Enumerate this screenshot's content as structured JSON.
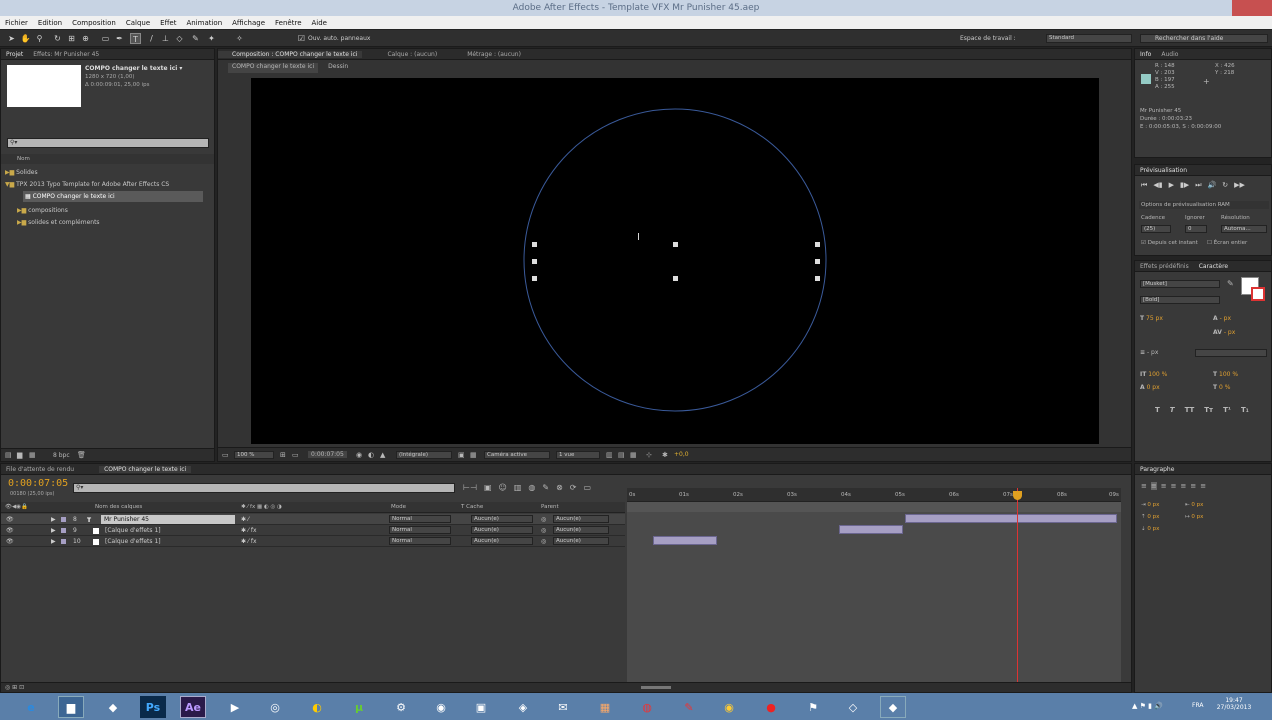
{
  "window": {
    "title": "Adobe After Effects - Template VFX Mr Punisher 45.aep"
  },
  "menu": [
    "Fichier",
    "Edition",
    "Composition",
    "Calque",
    "Effet",
    "Animation",
    "Affichage",
    "Fenêtre",
    "Aide"
  ],
  "toolbar": {
    "auto_open": "Ouv. auto. panneaux",
    "workspace_label": "Espace de travail :",
    "workspace": "Standard",
    "search_placeholder": "Rechercher dans l'aide"
  },
  "project": {
    "tabs": [
      "Projet",
      "Effets: Mr Punisher 45"
    ],
    "selected_name": "COMPO changer le texte ici ▾",
    "selected_size": "1280 x 720 (1,00)",
    "selected_duration": "Δ 0:00:09:01, 25,00 ips",
    "column_name": "Nom",
    "items": [
      "Solides",
      "TPX 2013 Typo Template for Adobe After Effects CS",
      "COMPO changer le texte ici",
      "compositions",
      "solides et compléments"
    ],
    "bpc": "8 bpc"
  },
  "comp": {
    "tabs": [
      "Composition : COMPO changer le texte ici",
      "Calque : (aucun)",
      "Métrage : (aucun)"
    ],
    "subtabs": [
      "COMPO changer le texte ici",
      "Dessin"
    ],
    "zoom": "100 %",
    "timecode": "0:00:07:05",
    "resolution": "(Intégrale)",
    "camera": "Caméra active",
    "views": "1 vue",
    "exposure": "+0,0"
  },
  "info": {
    "tabs": [
      "Info",
      "Audio"
    ],
    "r": "R : 148",
    "v": "V : 203",
    "b": "B : 197",
    "a": "A : 255",
    "x": "X : 426",
    "y": "Y : 218",
    "layer": "Mr Punisher 45",
    "duree": "Durée : 0:00:03:23",
    "range": "E : 0:00:05:03, S : 0:00:09:00"
  },
  "preview": {
    "tab": "Prévisualisation",
    "options": "Options de prévisualisation RAM",
    "cadence_label": "Cadence",
    "ignorer_label": "Ignorer",
    "resolution_label": "Résolution",
    "cadence": "(25)",
    "ignorer": "0",
    "resolution": "Automa...",
    "from_current": "Depuis cet instant",
    "full_screen": "Écran entier"
  },
  "character": {
    "tabs": [
      "Effets prédéfinis",
      "Caractère"
    ],
    "font": "[Musket]",
    "style": "[Bold]",
    "size": "75 px",
    "leading": "- px",
    "tracking": "- px",
    "vscale": "100 %",
    "hscale": "100 %",
    "baseline": "0 px",
    "tsume": "0 %"
  },
  "paragraph": {
    "tab": "Paragraphe",
    "indent_left": "0 px",
    "indent_right": "0 px",
    "indent_first": "0 px",
    "space_before": "0 px",
    "space_after": "0 px"
  },
  "timeline": {
    "tabs": [
      "File d'attente de rendu",
      "COMPO changer le texte ici"
    ],
    "timecode": "0:00:07:05",
    "frames": "00180 (25,00 ips)",
    "col_layer": "Nom des calques",
    "col_mode": "Mode",
    "col_cache": "T Cache",
    "col_parent": "Parent",
    "ruler": [
      "0s",
      "01s",
      "02s",
      "03s",
      "04s",
      "05s",
      "06s",
      "07s",
      "08s",
      "09s"
    ],
    "layers": [
      {
        "num": "8",
        "name": "Mr Punisher 45",
        "mode": "Normal",
        "cache": "Aucun(e)",
        "parent": "Aucun(e)"
      },
      {
        "num": "9",
        "name": "[Calque d'effets 1]",
        "mode": "Normal",
        "cache": "Aucun(e)",
        "parent": "Aucun(e)"
      },
      {
        "num": "10",
        "name": "[Calque d'effets 1]",
        "mode": "Normal",
        "cache": "Aucun(e)",
        "parent": "Aucun(e)"
      }
    ]
  },
  "taskbar": {
    "lang": "FRA",
    "time": "19:47",
    "date": "27/03/2013"
  }
}
